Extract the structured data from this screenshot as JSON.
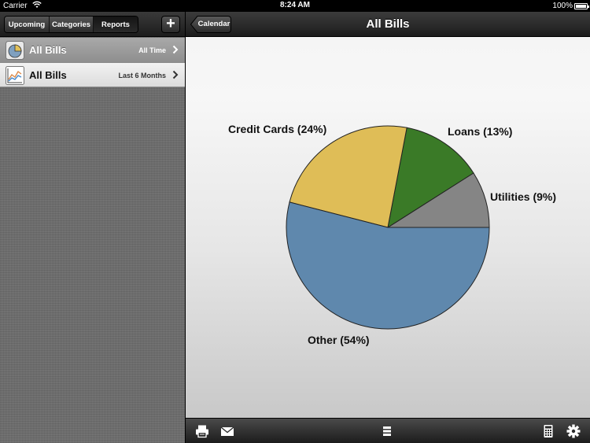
{
  "status": {
    "carrier": "Carrier",
    "time": "8:24 AM",
    "battery": "100%"
  },
  "left_toolbar": {
    "segments": [
      {
        "label": "Upcoming",
        "selected": false
      },
      {
        "label": "Categories",
        "selected": false
      },
      {
        "label": "Reports",
        "selected": true
      }
    ],
    "add_label": "+"
  },
  "reports": [
    {
      "title": "All Bills",
      "detail": "All Time",
      "icon": "pie-chart-icon",
      "selected": true
    },
    {
      "title": "All Bills",
      "detail": "Last 6 Months",
      "icon": "line-chart-icon",
      "selected": false
    }
  ],
  "nav": {
    "back_label": "Calendar",
    "title": "All Bills"
  },
  "chart_data": {
    "type": "pie",
    "title": "",
    "slices": [
      {
        "label": "Credit Cards (24%)",
        "name": "Credit Cards",
        "value": 24,
        "color": "#dfbd57"
      },
      {
        "label": "Loans (13%)",
        "name": "Loans",
        "value": 13,
        "color": "#3a7a27"
      },
      {
        "label": "Utilities (9%)",
        "name": "Utilities",
        "value": 9,
        "color": "#858585"
      },
      {
        "label": "Other (54%)",
        "name": "Other",
        "value": 54,
        "color": "#5f88ad"
      }
    ]
  },
  "toolbar_icons": [
    "printer-icon",
    "mail-icon",
    "list-icon",
    "calculator-icon",
    "gear-icon"
  ]
}
